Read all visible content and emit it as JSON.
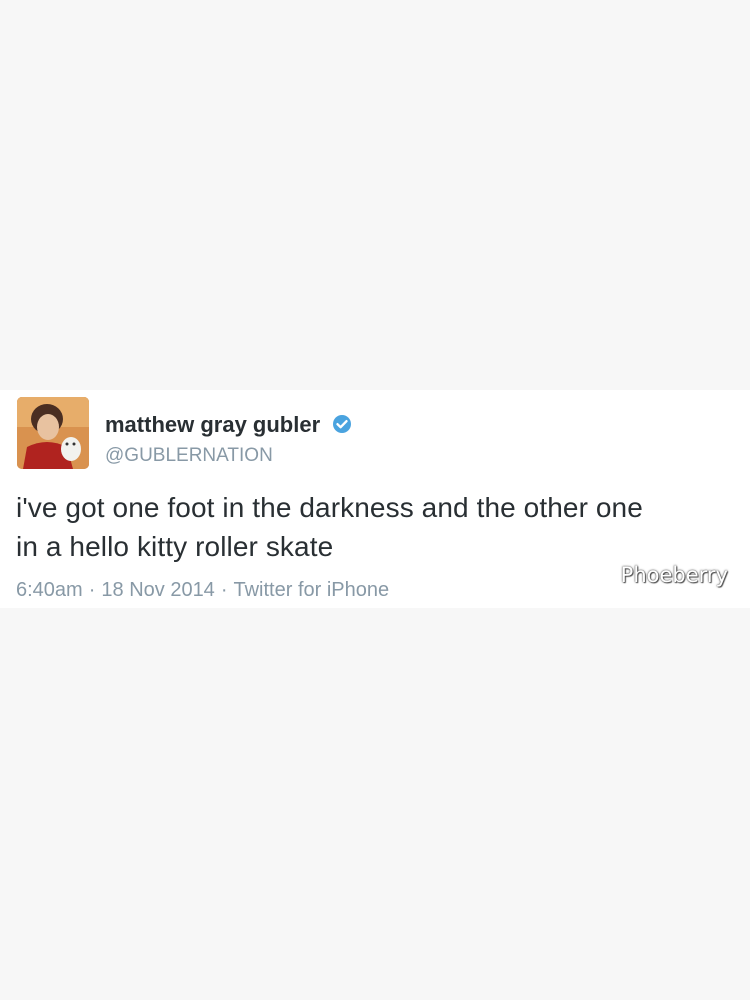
{
  "tweet": {
    "author": {
      "display_name": "matthew gray gubler",
      "handle": "@GUBLERNATION",
      "verified_icon": "verified-badge-icon",
      "verified_color": "#4aa3df"
    },
    "text_lines": [
      "i've got one foot in the darkness and the other one",
      "in a hello kitty roller skate"
    ],
    "time": "6:40am",
    "separator": "·",
    "date": "18 Nov 2014",
    "source": "Twitter for iPhone"
  },
  "watermark": "Phoeberry",
  "colors": {
    "background": "#f7f7f7",
    "card": "#ffffff",
    "text": "#292f33",
    "muted": "#8899a6"
  }
}
